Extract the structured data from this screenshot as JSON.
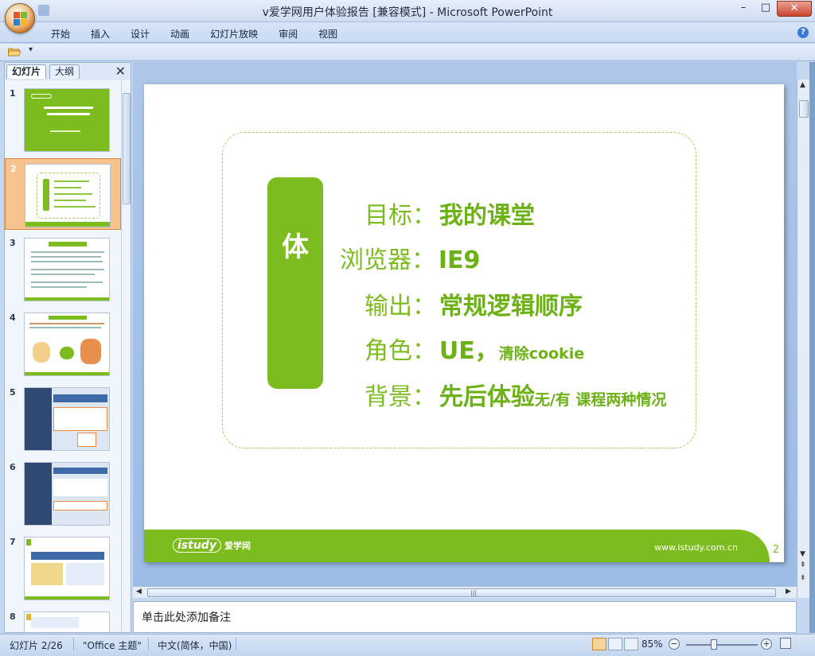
{
  "window": {
    "title": "v爱学网用户体验报告  [兼容模式] - Microsoft PowerPoint",
    "minimize": "–",
    "maximize": "□",
    "close": "✕"
  },
  "ribbon": {
    "tabs": [
      "开始",
      "插入",
      "设计",
      "动画",
      "幻灯片放映",
      "审阅",
      "视图"
    ]
  },
  "slides_pane": {
    "tab_slides": "幻灯片",
    "tab_outline": "大纲",
    "close": "✕",
    "selected": 2,
    "items": [
      {
        "num": "1"
      },
      {
        "num": "2"
      },
      {
        "num": "3"
      },
      {
        "num": "4"
      },
      {
        "num": "5"
      },
      {
        "num": "6"
      },
      {
        "num": "7"
      },
      {
        "num": "8"
      }
    ]
  },
  "slide": {
    "side_label": "体",
    "rows": [
      {
        "label": "目标：",
        "value": "我的课堂",
        "extra": ""
      },
      {
        "label": "浏览器：",
        "value": "IE9",
        "extra": ""
      },
      {
        "label": "输出：",
        "value": "常规逻辑顺序",
        "extra": ""
      },
      {
        "label": "角色：",
        "value": "UE，",
        "extra": "清除cookie"
      },
      {
        "label": "背景：",
        "value": "先后体验",
        "extra": "无/有 课程两种情况"
      }
    ],
    "footer_logo": "istudy",
    "footer_logo_cn": "爱学网",
    "footer_url": "www.istudy.com.cn",
    "page_number": "2"
  },
  "notes": {
    "placeholder": "单击此处添加备注"
  },
  "status": {
    "slide_pos": "幻灯片 2/26",
    "theme": "\"Office 主题\"",
    "language": "中文(简体，中国)",
    "zoom": "85%"
  },
  "colors": {
    "accent_green": "#7cbc1f",
    "selected_thumb": "#f6c28d"
  }
}
